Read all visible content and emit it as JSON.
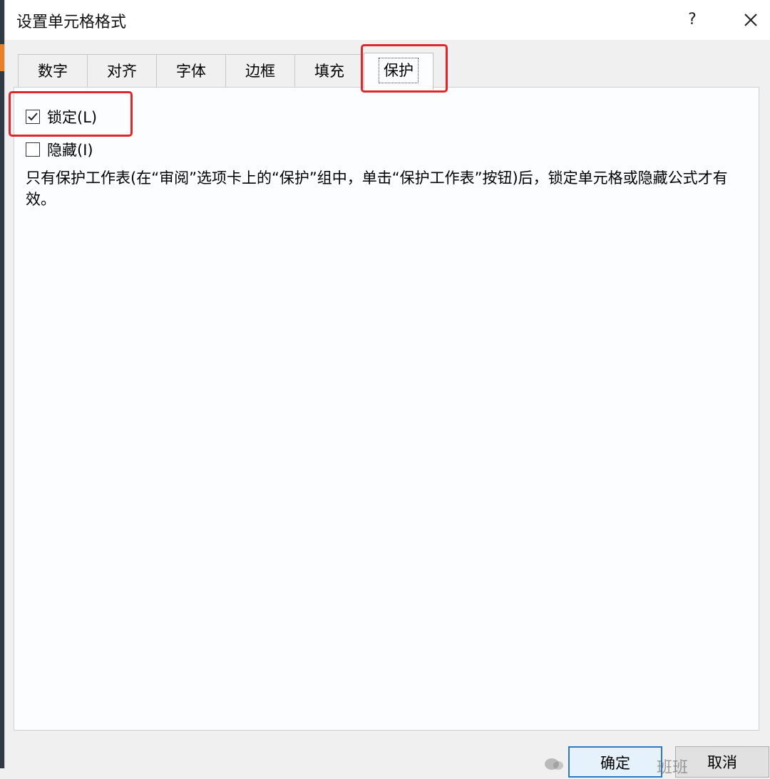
{
  "dialog": {
    "title": "设置单元格格式",
    "help_label": "?",
    "close_icon": "close-icon"
  },
  "tabs": [
    {
      "label": "数字"
    },
    {
      "label": "对齐"
    },
    {
      "label": "字体"
    },
    {
      "label": "边框"
    },
    {
      "label": "填充"
    },
    {
      "label": "保护",
      "active": true
    }
  ],
  "protection": {
    "locked_label": "锁定(L)",
    "locked_checked": true,
    "hidden_label": "隐藏(I)",
    "hidden_checked": false,
    "description": "只有保护工作表(在“审阅”选项卡上的“保护”组中，单击“保护工作表”按钮)后，锁定单元格或隐藏公式才有效。"
  },
  "footer": {
    "ok_label": "确定",
    "cancel_label": "取消"
  },
  "watermark": {
    "text": "班班"
  },
  "colors": {
    "highlight": "#e0262a",
    "primary_border": "#2b78c6"
  }
}
